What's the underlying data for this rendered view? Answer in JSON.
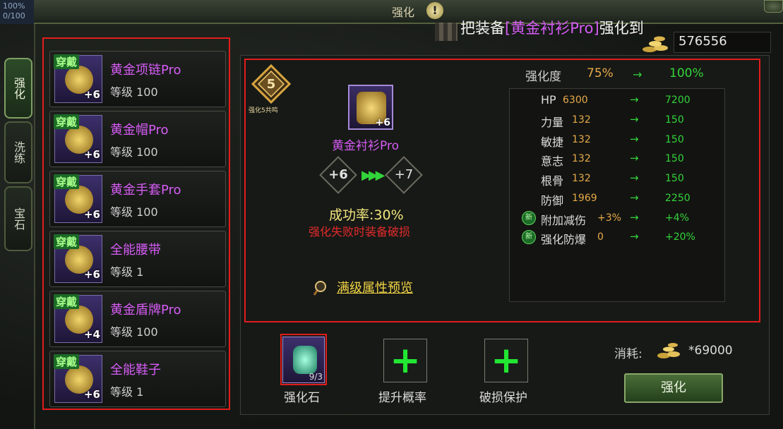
{
  "window": {
    "title": "强化",
    "hud_fragment": "100%",
    "hud_fragment2": "0/100"
  },
  "headline": {
    "prefix": "把装备",
    "item": "[黄金衬衫Pro]",
    "suffix": "强化到"
  },
  "gold": {
    "amount": "576556"
  },
  "side_tabs": [
    {
      "label": "强化",
      "active": true
    },
    {
      "label": "洗练",
      "active": false
    },
    {
      "label": "宝石",
      "active": false
    }
  ],
  "equipment_list": [
    {
      "tag": "穿戴",
      "name": "黄金项链Pro",
      "level": "等级 100",
      "plus": "+6"
    },
    {
      "tag": "穿戴",
      "name": "黄金帽Pro",
      "level": "等级 100",
      "plus": "+6"
    },
    {
      "tag": "穿戴",
      "name": "黄金手套Pro",
      "level": "等级 100",
      "plus": "+6"
    },
    {
      "tag": "穿戴",
      "name": "全能腰带",
      "level": "等级 1",
      "plus": "+6"
    },
    {
      "tag": "穿戴",
      "name": "黄金盾牌Pro",
      "level": "等级 100",
      "plus": "+4"
    },
    {
      "tag": "穿戴",
      "name": "全能鞋子",
      "level": "等级 1",
      "plus": "+6"
    }
  ],
  "resonance": {
    "number": "5",
    "label": "强化5共鸣"
  },
  "selected": {
    "name": "黄金衬衫Pro",
    "plus": "+6",
    "from": "+6",
    "to": "+7"
  },
  "success": {
    "rate": "成功率:30%",
    "warning": "强化失败时装备破损"
  },
  "preview_link": "满级属性预览",
  "degree": {
    "label": "强化度",
    "from": "75%",
    "arrow": "→",
    "to": "100%"
  },
  "stats": [
    {
      "label": "HP",
      "from": "6300",
      "to": "7200",
      "new": false
    },
    {
      "label": "力量",
      "from": "132",
      "to": "150",
      "new": false
    },
    {
      "label": "敏捷",
      "from": "132",
      "to": "150",
      "new": false
    },
    {
      "label": "意志",
      "from": "132",
      "to": "150",
      "new": false
    },
    {
      "label": "根骨",
      "from": "132",
      "to": "150",
      "new": false
    },
    {
      "label": "防御",
      "from": "1969",
      "to": "2250",
      "new": false
    },
    {
      "label": "附加减伤",
      "from": "+3%",
      "to": "+4%",
      "new": true
    },
    {
      "label": "强化防爆",
      "from": "0",
      "to": "+20%",
      "new": true
    }
  ],
  "stat_arrow": "→",
  "new_badge": "新",
  "materials": [
    {
      "label": "强化石",
      "count": "9/3"
    },
    {
      "label": "提升概率",
      "plus": "+"
    },
    {
      "label": "破损保护",
      "plus": "+"
    }
  ],
  "cost": {
    "label": "消耗:",
    "amount": "*69000"
  },
  "enhance_button": "强化"
}
